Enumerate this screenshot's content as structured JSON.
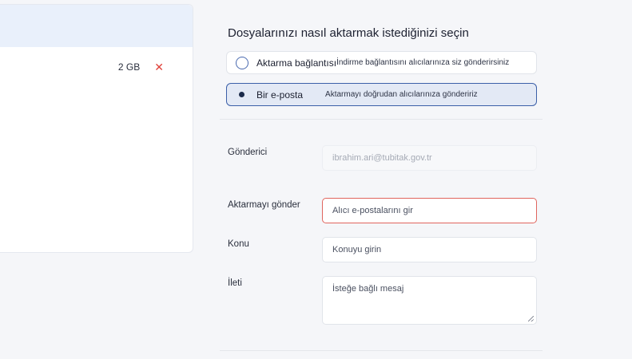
{
  "file_panel": {
    "file": {
      "size": "2 GB",
      "remove_icon": "close-icon",
      "remove_glyph": "✕"
    }
  },
  "form": {
    "title": "Dosyalarınızı nasıl aktarmak istediğinizi seçin",
    "options": [
      {
        "label": "Aktarma bağlantısı",
        "description": "İndirme bağlantısını alıcılarınıza siz gönderirsiniz",
        "selected": false
      },
      {
        "label": "Bir e-posta",
        "description": "Aktarmayı doğrudan alıcılarınıza göndeririz",
        "selected": true
      }
    ],
    "sender": {
      "label": "Gönderici",
      "value": "ibrahim.ari@tubitak.gov.tr"
    },
    "recipients": {
      "label": "Aktarmayı gönder",
      "placeholder": "Alıcı e-postalarını gir"
    },
    "subject": {
      "label": "Konu",
      "placeholder": "Konuyu girin"
    },
    "message": {
      "label": "İleti",
      "placeholder": "İsteğe bağlı mesaj"
    }
  },
  "colors": {
    "accent": "#3b5fa8",
    "selected_bg": "#e3e9f5",
    "error_border": "#e0655e",
    "remove_red": "#e0413a"
  }
}
